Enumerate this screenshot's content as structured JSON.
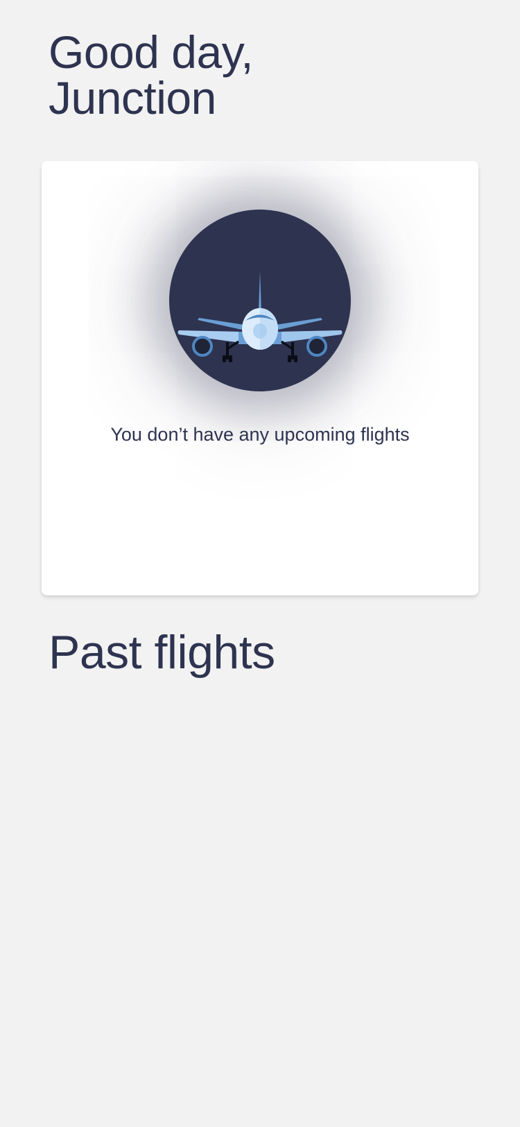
{
  "greeting": {
    "line1": "Good day,",
    "line2": "Junction"
  },
  "upcoming_card": {
    "illustration": "airplane-icon",
    "empty_message": "You don’t have any upcoming flights"
  },
  "past_flights": {
    "title": "Past flights"
  },
  "colors": {
    "background": "#f2f2f2",
    "text": "#2e3350",
    "card": "#ffffff",
    "circle": "#2e3350",
    "plane_light": "#a8cdf0",
    "plane_mid": "#6a9ed4",
    "plane_dark": "#3f74b4"
  }
}
